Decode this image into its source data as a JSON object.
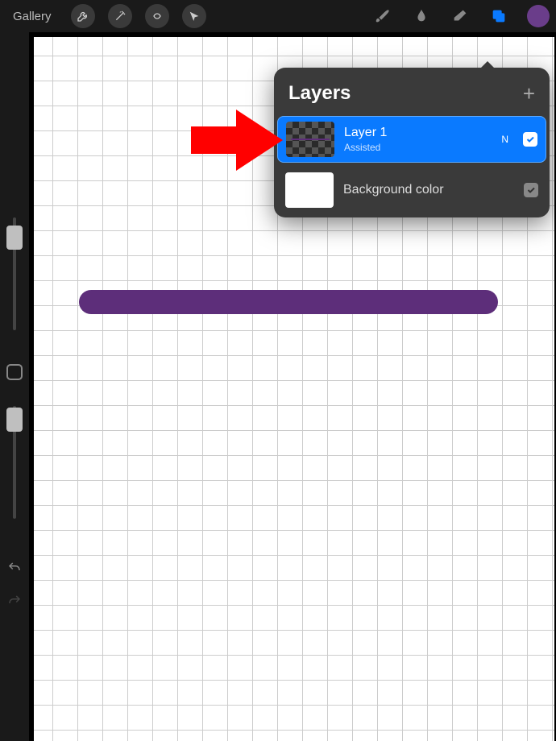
{
  "topbar": {
    "gallery_label": "Gallery"
  },
  "layers_panel": {
    "title": "Layers",
    "layers": [
      {
        "name": "Layer 1",
        "subtitle": "Assisted",
        "blend_letter": "N",
        "visible": true,
        "selected": true
      },
      {
        "name": "Background color",
        "visible": true
      }
    ]
  },
  "colors": {
    "brand_purple": "#5d2e7a",
    "selection_blue": "#0a7aff"
  }
}
